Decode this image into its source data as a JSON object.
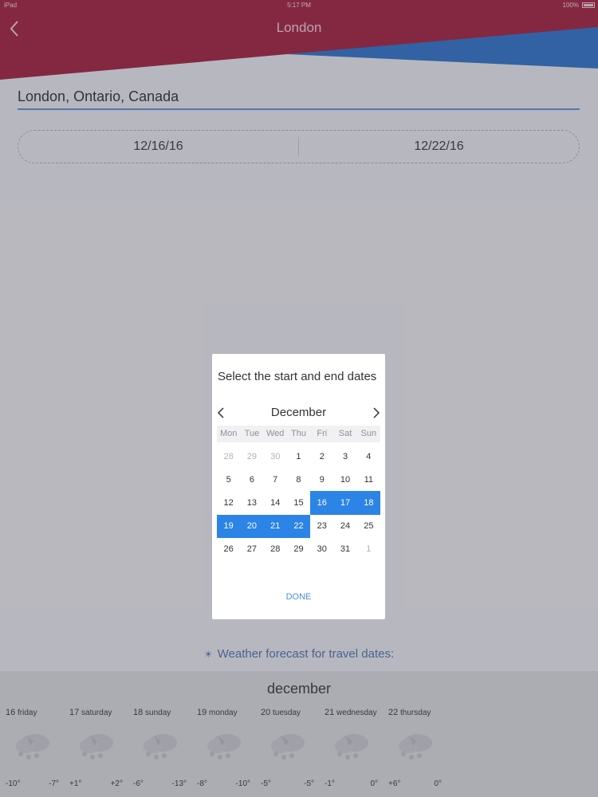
{
  "status_bar": {
    "left": "iPad",
    "time": "5:17 PM",
    "battery": "100%"
  },
  "header": {
    "title": "London"
  },
  "location": {
    "value": "London, Ontario, Canada"
  },
  "dates": {
    "start": "12/16/16",
    "end": "12/22/16"
  },
  "colors": {
    "header_red": "#a01a3a",
    "header_blue": "#2a6ec4",
    "accent_blue": "#2b84e6",
    "underline_blue": "#5b8bd0"
  },
  "dialog": {
    "title": "Select the start and end dates",
    "month": "December",
    "weekdays": [
      "Mon",
      "Tue",
      "Wed",
      "Thu",
      "Fri",
      "Sat",
      "Sun"
    ],
    "weeks": [
      [
        {
          "d": "28",
          "muted": true
        },
        {
          "d": "29",
          "muted": true
        },
        {
          "d": "30",
          "muted": true
        },
        {
          "d": "1"
        },
        {
          "d": "2"
        },
        {
          "d": "3"
        },
        {
          "d": "4"
        }
      ],
      [
        {
          "d": "5"
        },
        {
          "d": "6"
        },
        {
          "d": "7"
        },
        {
          "d": "8"
        },
        {
          "d": "9"
        },
        {
          "d": "10"
        },
        {
          "d": "11"
        }
      ],
      [
        {
          "d": "12"
        },
        {
          "d": "13"
        },
        {
          "d": "14"
        },
        {
          "d": "15"
        },
        {
          "d": "16",
          "selected": true
        },
        {
          "d": "17",
          "selected": true
        },
        {
          "d": "18",
          "selected": true
        }
      ],
      [
        {
          "d": "19",
          "selected": true
        },
        {
          "d": "20",
          "selected": true
        },
        {
          "d": "21",
          "selected": true
        },
        {
          "d": "22",
          "selected": true
        },
        {
          "d": "23"
        },
        {
          "d": "24"
        },
        {
          "d": "25"
        }
      ],
      [
        {
          "d": "26"
        },
        {
          "d": "27"
        },
        {
          "d": "28"
        },
        {
          "d": "29"
        },
        {
          "d": "30"
        },
        {
          "d": "31"
        },
        {
          "d": "1",
          "muted": true
        }
      ]
    ],
    "done_label": "DONE"
  },
  "forecast": {
    "title": "Weather forecast for travel dates:",
    "icon": "sun-icon",
    "month": "december",
    "days": [
      {
        "num": "16",
        "name": "friday",
        "lo": "-10°",
        "hi": "-7°",
        "icon": "snow-cloud-icon"
      },
      {
        "num": "17",
        "name": "saturday",
        "lo": "+1°",
        "hi": "+2°",
        "icon": "snow-cloud-icon"
      },
      {
        "num": "18",
        "name": "sunday",
        "lo": "-6°",
        "hi": "-13°",
        "icon": "snow-cloud-icon"
      },
      {
        "num": "19",
        "name": "monday",
        "lo": "-8°",
        "hi": "-10°",
        "icon": "snow-cloud-icon"
      },
      {
        "num": "20",
        "name": "tuesday",
        "lo": "-5°",
        "hi": "-5°",
        "icon": "snow-cloud-icon"
      },
      {
        "num": "21",
        "name": "wednesday",
        "lo": "-1°",
        "hi": "0°",
        "icon": "snow-cloud-icon"
      },
      {
        "num": "22",
        "name": "thursday",
        "lo": "+6°",
        "hi": "0°",
        "icon": "snow-cloud-icon"
      }
    ]
  }
}
